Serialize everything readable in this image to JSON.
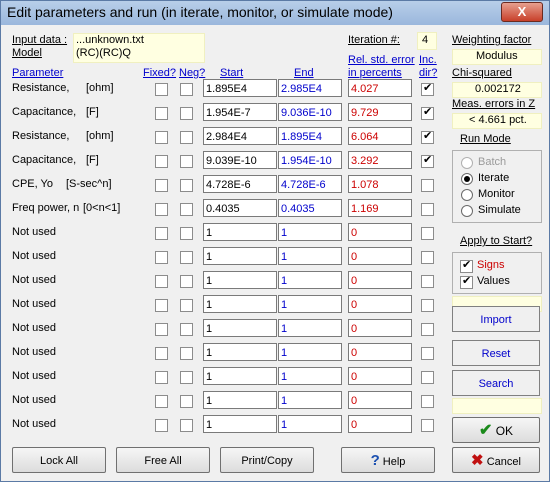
{
  "window": {
    "title": "Edit parameters and run (in iterate, monitor, or simulate mode)",
    "close_label": "X"
  },
  "info": {
    "input_label": "Input data :",
    "input_value": "...unknown.txt",
    "model_label": "Model",
    "model_value": "(RC)(RC)Q",
    "iteration_label": "Iteration #:",
    "iteration_value": "4"
  },
  "headers": {
    "parameter": "Parameter",
    "fixed": "Fixed?",
    "neg": "Neg?",
    "start": "Start",
    "end": "End",
    "relerr": "Rel. std. error",
    "relerr2": "in percents",
    "inc": "Inc.",
    "inc2": "dir?"
  },
  "rows": [
    {
      "name": "Resistance,",
      "unit": "[ohm]",
      "fixed": false,
      "neg": false,
      "start": "1.895E4",
      "end": "2.985E4",
      "err": "4.027",
      "inc": true
    },
    {
      "name": "Capacitance,",
      "unit": "[F]",
      "fixed": false,
      "neg": false,
      "start": "1.954E-7",
      "end": "9.036E-10",
      "err": "9.729",
      "inc": true
    },
    {
      "name": "Resistance,",
      "unit": "[ohm]",
      "fixed": false,
      "neg": false,
      "start": "2.984E4",
      "end": "1.895E4",
      "err": "6.064",
      "inc": true
    },
    {
      "name": "Capacitance,",
      "unit": "[F]",
      "fixed": false,
      "neg": false,
      "start": "9.039E-10",
      "end": "1.954E-10",
      "err": "3.292",
      "inc": true
    },
    {
      "name": "CPE,  Yo",
      "unit": "[S-sec^n]",
      "fixed": false,
      "neg": false,
      "start": "4.728E-6",
      "end": "4.728E-6",
      "err": "1.078",
      "inc": false
    },
    {
      "name": "Freq power, n",
      "unit": "[0<n<1]",
      "fixed": false,
      "neg": false,
      "start": "0.4035",
      "end": "0.4035",
      "err": "1.169",
      "inc": false
    },
    {
      "name": "Not used",
      "unit": "",
      "fixed": false,
      "neg": false,
      "start": "1",
      "end": "1",
      "err": "0",
      "inc": false
    },
    {
      "name": "Not used",
      "unit": "",
      "fixed": false,
      "neg": false,
      "start": "1",
      "end": "1",
      "err": "0",
      "inc": false
    },
    {
      "name": "Not used",
      "unit": "",
      "fixed": false,
      "neg": false,
      "start": "1",
      "end": "1",
      "err": "0",
      "inc": false
    },
    {
      "name": "Not used",
      "unit": "",
      "fixed": false,
      "neg": false,
      "start": "1",
      "end": "1",
      "err": "0",
      "inc": false
    },
    {
      "name": "Not used",
      "unit": "",
      "fixed": false,
      "neg": false,
      "start": "1",
      "end": "1",
      "err": "0",
      "inc": false
    },
    {
      "name": "Not used",
      "unit": "",
      "fixed": false,
      "neg": false,
      "start": "1",
      "end": "1",
      "err": "0",
      "inc": false
    },
    {
      "name": "Not used",
      "unit": "",
      "fixed": false,
      "neg": false,
      "start": "1",
      "end": "1",
      "err": "0",
      "inc": false
    },
    {
      "name": "Not used",
      "unit": "",
      "fixed": false,
      "neg": false,
      "start": "1",
      "end": "1",
      "err": "0",
      "inc": false
    },
    {
      "name": "Not used",
      "unit": "",
      "fixed": false,
      "neg": false,
      "start": "1",
      "end": "1",
      "err": "0",
      "inc": false
    }
  ],
  "right": {
    "weighting_label": "Weighting factor",
    "weighting_value": "Modulus",
    "chisq_label": "Chi-squared",
    "chisq_value": "0.002172",
    "meas_label": "Meas. errors in Z",
    "meas_value": "< 4.661 pct.",
    "runmode_label": "Run Mode",
    "modes": [
      {
        "label": "Batch",
        "selected": false,
        "disabled": true
      },
      {
        "label": "Iterate",
        "selected": true,
        "disabled": false
      },
      {
        "label": "Monitor",
        "selected": false,
        "disabled": false
      },
      {
        "label": "Simulate",
        "selected": false,
        "disabled": false
      }
    ],
    "apply_label": "Apply to Start?",
    "signs_label": "Signs",
    "values_label": "Values",
    "import_label": "Import",
    "reset_label": "Reset",
    "search_label": "Search",
    "ok_label": "OK",
    "cancel_label": "Cancel"
  },
  "bottom": {
    "lock_label": "Lock All",
    "free_label": "Free All",
    "print_label": "Print/Copy",
    "help_label": "Help"
  },
  "colors": {
    "link": "#0000cc",
    "error": "#cc0000",
    "yellow_box": "#ffffe1"
  }
}
